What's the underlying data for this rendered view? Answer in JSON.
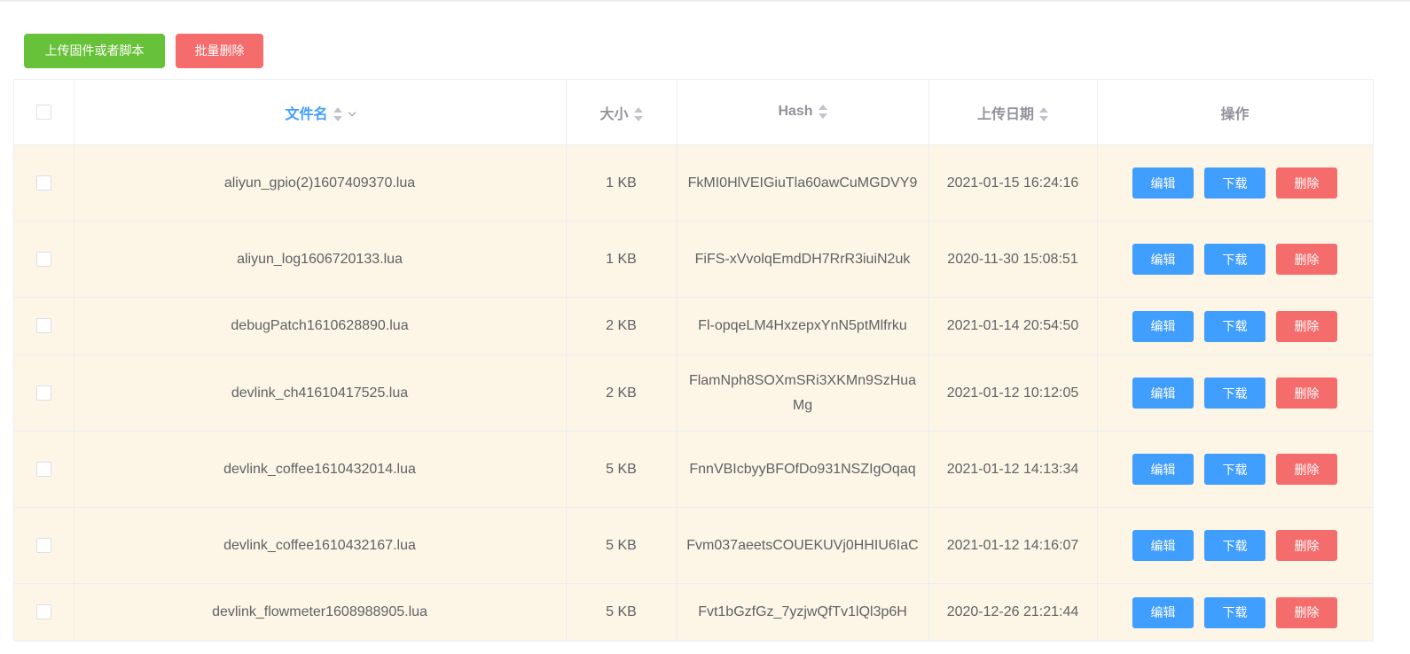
{
  "toolbar": {
    "upload_label": "上传固件或者脚本",
    "batch_delete_label": "批量删除"
  },
  "table": {
    "columns": {
      "filename": "文件名",
      "size": "大小",
      "hash": "Hash",
      "upload_date": "上传日期",
      "actions": "操作"
    },
    "action_labels": {
      "edit": "编辑",
      "download": "下载",
      "delete": "删除"
    },
    "rows": [
      {
        "filename": "aliyun_gpio(2)1607409370.lua",
        "size": "1 KB",
        "hash": "FkMI0HlVEIGiuTla60awCuMGDVY9",
        "date": "2021-01-15 16:24:16"
      },
      {
        "filename": "aliyun_log1606720133.lua",
        "size": "1 KB",
        "hash": "FiFS-xVvolqEmdDH7RrR3iuiN2uk",
        "date": "2020-11-30 15:08:51"
      },
      {
        "filename": "debugPatch1610628890.lua",
        "size": "2 KB",
        "hash": "Fl-opqeLM4HxzepxYnN5ptMlfrku",
        "date": "2021-01-14 20:54:50"
      },
      {
        "filename": "devlink_ch41610417525.lua",
        "size": "2 KB",
        "hash": "FlamNph8SOXmSRi3XKMn9SzHuaMg",
        "date": "2021-01-12 10:12:05"
      },
      {
        "filename": "devlink_coffee1610432014.lua",
        "size": "5 KB",
        "hash": "FnnVBIcbyyBFOfDo931NSZIgOqaq",
        "date": "2021-01-12 14:13:34"
      },
      {
        "filename": "devlink_coffee1610432167.lua",
        "size": "5 KB",
        "hash": "Fvm037aeetsCOUEKUVj0HHIU6IaC",
        "date": "2021-01-12 14:16:07"
      },
      {
        "filename": "devlink_flowmeter1608988905.lua",
        "size": "5 KB",
        "hash": "Fvt1bGzfGz_7yzjwQfTv1lQl3p6H",
        "date": "2020-12-26 21:21:44"
      }
    ]
  }
}
